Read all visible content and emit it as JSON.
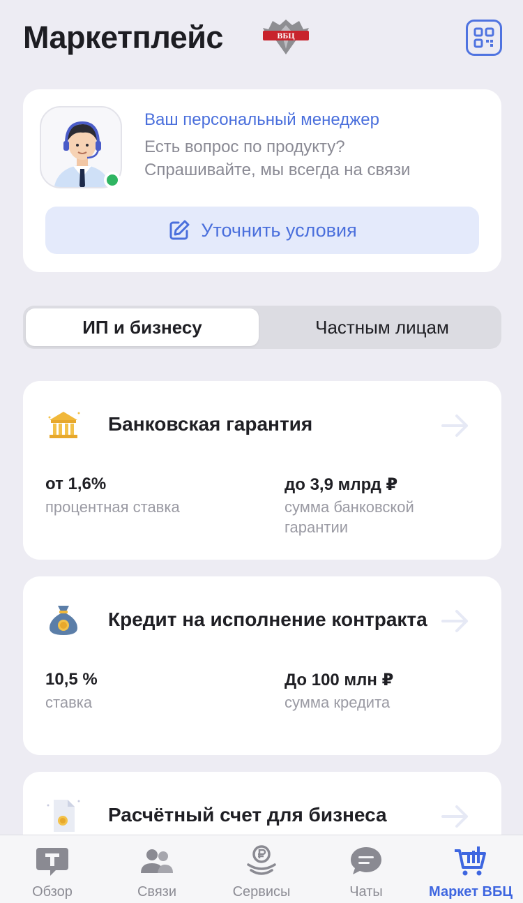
{
  "header": {
    "title": "Маркетплейс",
    "logo_text": "ВБЦ"
  },
  "manager": {
    "title": "Ваш персональный менеджер",
    "line1": "Есть вопрос по продукту?",
    "line2": "Спрашивайте, мы всегда на связи",
    "button_label": "Уточнить условия",
    "online": true
  },
  "segments": {
    "active": "ИП и бизнесу",
    "inactive": "Частным лицам"
  },
  "products": [
    {
      "title": "Банковская гарантия",
      "left_value": "от 1,6%",
      "left_label": "процентная ставка",
      "right_value": "до 3,9 млрд ₽",
      "right_label": "сумма банковской гарантии"
    },
    {
      "title": "Кредит на исполнение контракта",
      "left_value": "10,5 %",
      "left_label": "ставка",
      "right_value": "До 100 млн ₽",
      "right_label": "сумма кредита"
    },
    {
      "title": "Расчётный счет для бизнеса"
    }
  ],
  "tabbar": [
    {
      "label": "Обзор",
      "icon": "t-logo-icon"
    },
    {
      "label": "Связи",
      "icon": "people-icon"
    },
    {
      "label": "Сервисы",
      "icon": "ruble-stack-icon"
    },
    {
      "label": "Чаты",
      "icon": "chat-bubble-icon"
    },
    {
      "label": "Маркет ВБЦ",
      "icon": "cart-icon",
      "active": true
    }
  ],
  "colors": {
    "accent": "#4a6fdc",
    "background": "#edecf3",
    "online": "#2fb562",
    "active_tab": "#3e66e0"
  }
}
